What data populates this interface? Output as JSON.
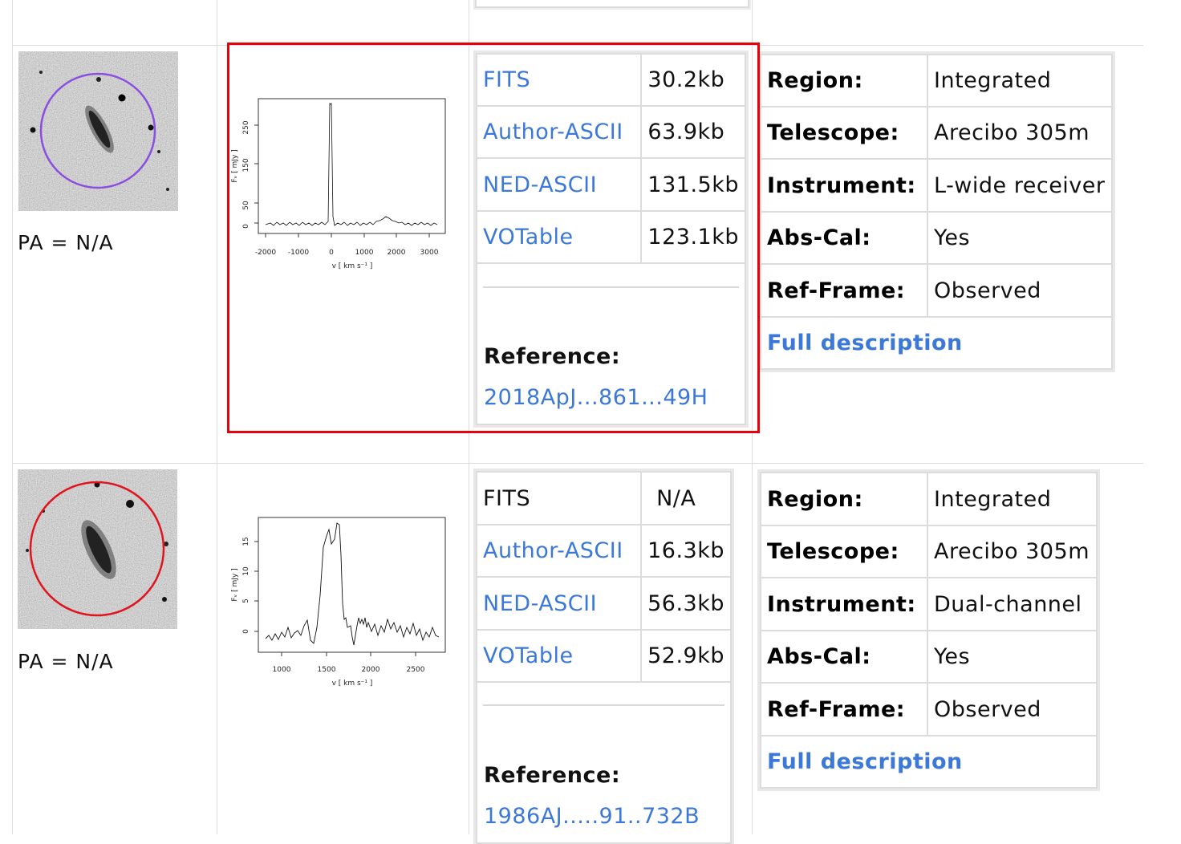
{
  "rows": [
    {
      "pa_text": "PA = N/A",
      "ellipse_color": "#8a4fe0",
      "spectrum": {
        "y_axis_label": "Fᵥ [ mJy ]",
        "x_axis_label": "v [ km s⁻¹ ]",
        "x_ticks": [
          "-2000",
          "-1000",
          "0",
          "1000",
          "2000",
          "3000"
        ],
        "y_ticks": [
          "0",
          "50",
          "150",
          "250"
        ]
      },
      "downloads": [
        {
          "label": "FITS",
          "size": "30.2kb",
          "is_link": true
        },
        {
          "label": "Author-ASCII",
          "size": "63.9kb",
          "is_link": true
        },
        {
          "label": "NED-ASCII",
          "size": "131.5kb",
          "is_link": true
        },
        {
          "label": "VOTable",
          "size": "123.1kb",
          "is_link": true
        }
      ],
      "reference_label": "Reference:",
      "reference_code": "2018ApJ...861...49H",
      "meta": [
        {
          "key": "Region:",
          "value": "Integrated"
        },
        {
          "key": "Telescope:",
          "value": "Arecibo 305m"
        },
        {
          "key": "Instrument:",
          "value": "L-wide receiver"
        },
        {
          "key": "Abs-Cal:",
          "value": "Yes"
        },
        {
          "key": "Ref-Frame:",
          "value": "Observed"
        }
      ],
      "full_description": "Full description"
    },
    {
      "pa_text": "PA = N/A",
      "ellipse_color": "#e0141e",
      "spectrum": {
        "y_axis_label": "Fᵥ [ mJy ]",
        "x_axis_label": "v [ km s⁻¹ ]",
        "x_ticks": [
          "1000",
          "1500",
          "2000",
          "2500"
        ],
        "y_ticks": [
          "0",
          "5",
          "10",
          "15"
        ]
      },
      "downloads": [
        {
          "label": "FITS",
          "size": "N/A",
          "is_link": false
        },
        {
          "label": "Author-ASCII",
          "size": "16.3kb",
          "is_link": true
        },
        {
          "label": "NED-ASCII",
          "size": "56.3kb",
          "is_link": true
        },
        {
          "label": "VOTable",
          "size": "52.9kb",
          "is_link": true
        }
      ],
      "reference_label": "Reference:",
      "reference_code": "1986AJ.....91..732B",
      "meta": [
        {
          "key": "Region:",
          "value": "Integrated"
        },
        {
          "key": "Telescope:",
          "value": "Arecibo 305m"
        },
        {
          "key": "Instrument:",
          "value": "Dual-channel"
        },
        {
          "key": "Abs-Cal:",
          "value": "Yes"
        },
        {
          "key": "Ref-Frame:",
          "value": "Observed"
        }
      ],
      "full_description": "Full description"
    }
  ],
  "colors": {
    "link": "#3c78d8",
    "highlight_box": "#e8000b",
    "grid_line": "#dcdcdc"
  }
}
